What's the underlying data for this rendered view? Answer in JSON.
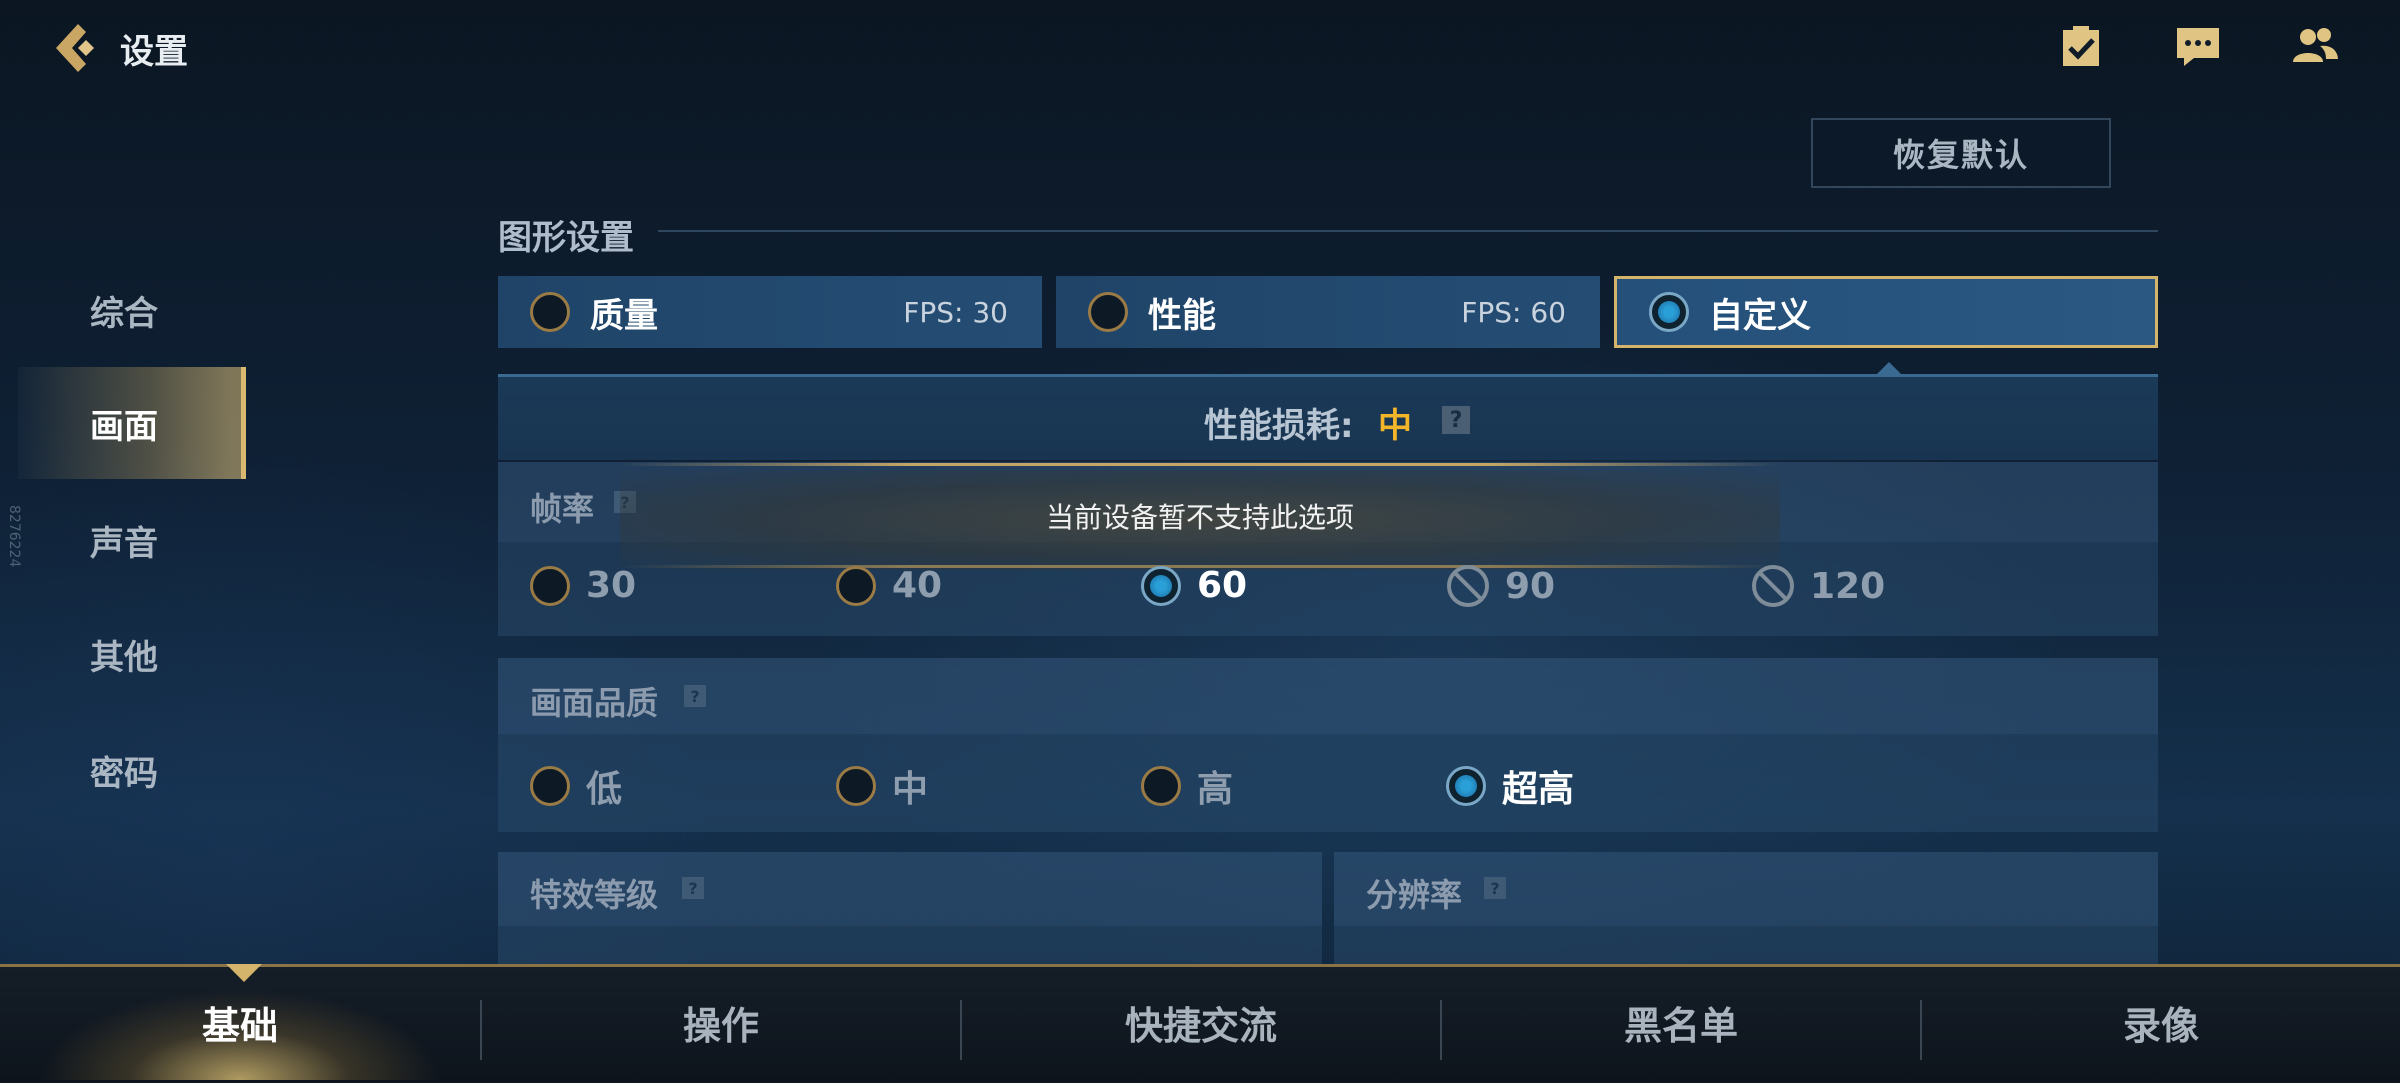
{
  "header": {
    "title": "设置",
    "restore_label": "恢复默认"
  },
  "top_icons": [
    "checklist-icon",
    "chat-icon",
    "friends-icon"
  ],
  "sidebar": {
    "items": [
      {
        "label": "综合",
        "active": false
      },
      {
        "label": "画面",
        "active": true
      },
      {
        "label": "声音",
        "active": false
      },
      {
        "label": "其他",
        "active": false
      },
      {
        "label": "密码",
        "active": false
      }
    ],
    "side_code": "8276224"
  },
  "graphics": {
    "section_title": "图形设置",
    "presets": [
      {
        "label": "质量",
        "fps": "FPS: 30",
        "selected": false
      },
      {
        "label": "性能",
        "fps": "FPS: 60",
        "selected": false
      },
      {
        "label": "自定义",
        "fps": "",
        "selected": true
      }
    ],
    "perf_label": "性能损耗:",
    "perf_value": "中",
    "help": "?"
  },
  "framerate": {
    "title": "帧率",
    "options": [
      {
        "label": "30",
        "state": "off"
      },
      {
        "label": "40",
        "state": "off"
      },
      {
        "label": "60",
        "state": "on"
      },
      {
        "label": "90",
        "state": "disabled"
      },
      {
        "label": "120",
        "state": "disabled"
      }
    ]
  },
  "toast": {
    "text": "当前设备暂不支持此选项"
  },
  "quality": {
    "title": "画面品质",
    "options": [
      {
        "label": "低",
        "state": "off"
      },
      {
        "label": "中",
        "state": "off"
      },
      {
        "label": "高",
        "state": "off"
      },
      {
        "label": "超高",
        "state": "on"
      }
    ]
  },
  "effects": {
    "title": "特效等级"
  },
  "resolution": {
    "title": "分辨率"
  },
  "bottom_tabs": [
    {
      "label": "基础",
      "active": true
    },
    {
      "label": "操作",
      "active": false
    },
    {
      "label": "快捷交流",
      "active": false
    },
    {
      "label": "黑名单",
      "active": false
    },
    {
      "label": "录像",
      "active": false
    }
  ],
  "colors": {
    "accent_gold": "#d4b46a",
    "perf_value": "#f2b628",
    "radio_on": "#2aa0d8"
  }
}
